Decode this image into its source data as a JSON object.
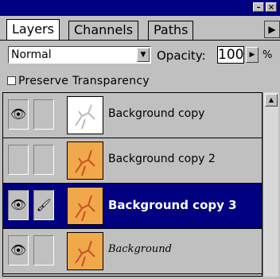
{
  "window": {
    "minimize_label": "–",
    "close_label": "×"
  },
  "tabs": [
    {
      "label": "Layers",
      "active": true
    },
    {
      "label": "Channels",
      "active": false
    },
    {
      "label": "Paths",
      "active": false
    }
  ],
  "tab_menu_icon": "right-triangle",
  "blend_mode": {
    "value": "Normal"
  },
  "opacity": {
    "label": "Opacity:",
    "value": "100",
    "unit": "%"
  },
  "preserve_transparency": {
    "label": "Preserve Transparency",
    "checked": false
  },
  "layers": [
    {
      "name": "Background copy",
      "visible": true,
      "linked": false,
      "thumb": "white",
      "selected": false
    },
    {
      "name": "Background copy 2",
      "visible": false,
      "linked": false,
      "thumb": "orange",
      "selected": false
    },
    {
      "name": "Background copy 3",
      "visible": true,
      "linked": true,
      "thumb": "orange",
      "selected": true
    },
    {
      "name": "Background",
      "visible": true,
      "linked": false,
      "thumb": "orange",
      "selected": false
    }
  ],
  "colors": {
    "selection": "#000080",
    "panel": "#c0c0c0",
    "thumb_orange": "#f0a94a"
  }
}
